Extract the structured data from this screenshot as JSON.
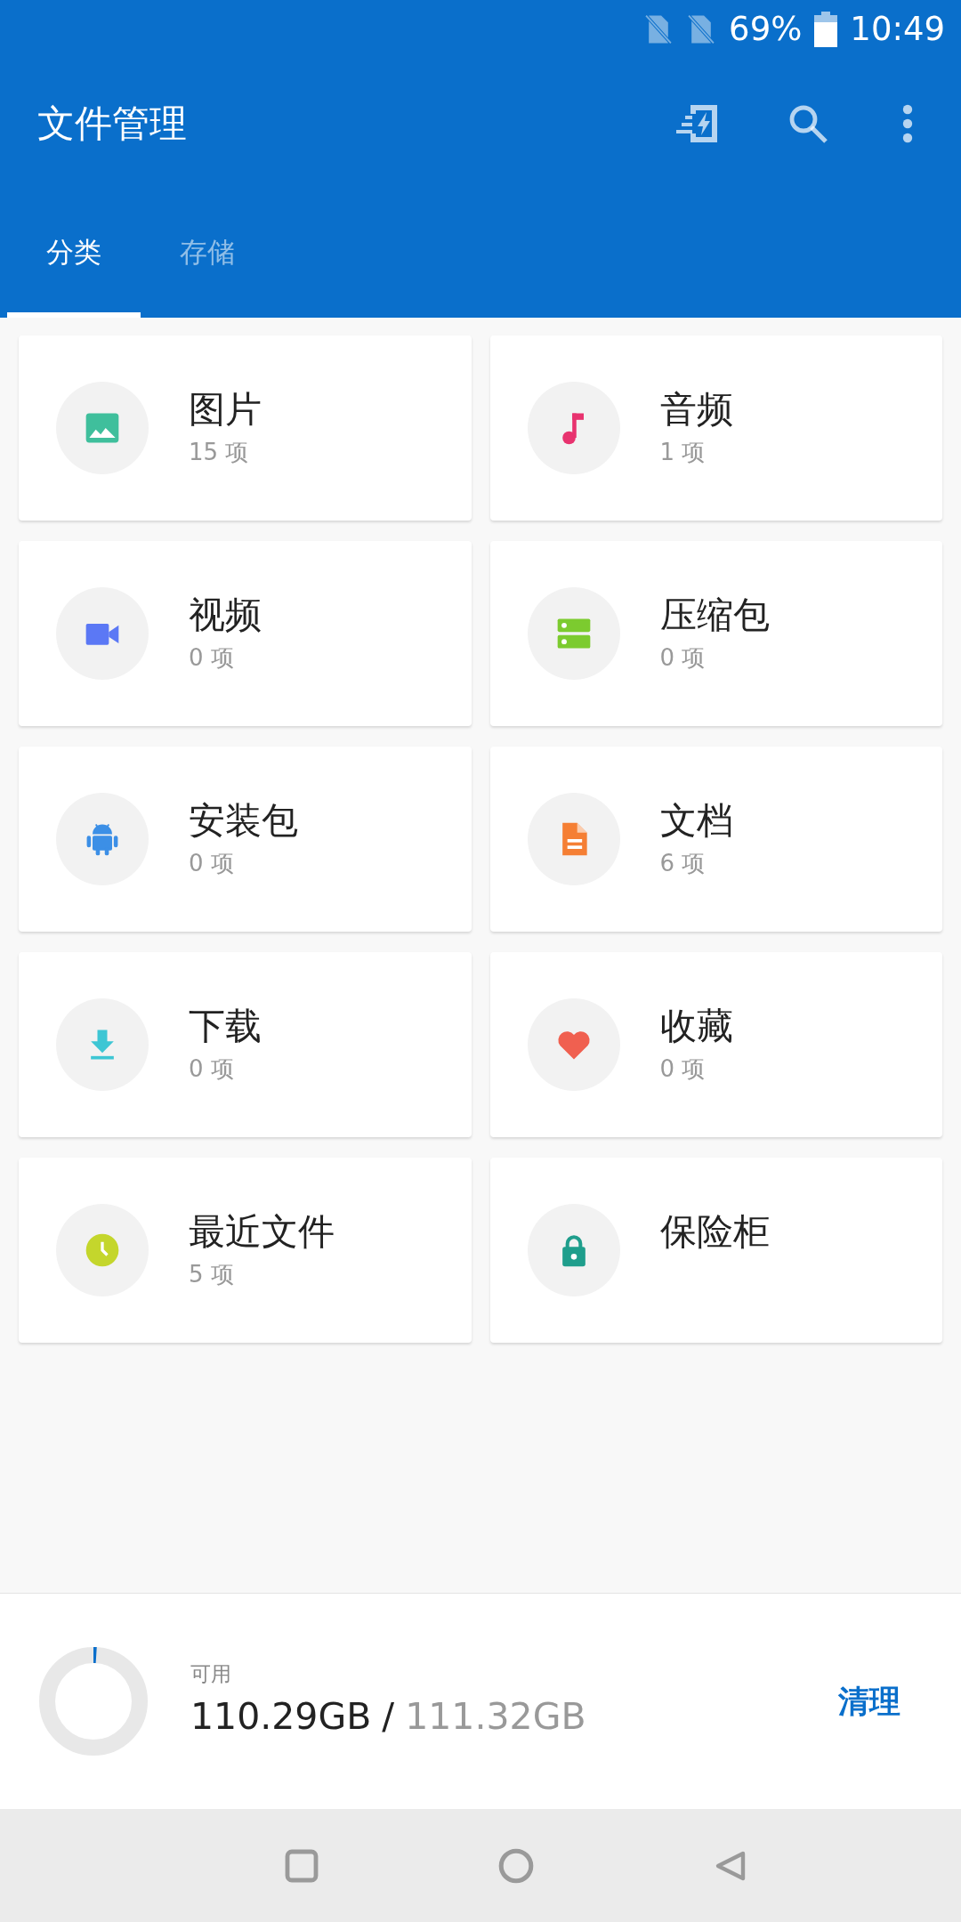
{
  "status_bar": {
    "battery": "69%",
    "time": "10:49"
  },
  "app_bar": {
    "title": "文件管理"
  },
  "tabs": [
    {
      "label": "分类",
      "selected": true
    },
    {
      "label": "存储",
      "selected": false
    }
  ],
  "categories": [
    {
      "kind": "image",
      "color": "#3fbf9c",
      "name": "图片",
      "count": "15 项"
    },
    {
      "kind": "music",
      "color": "#e8336f",
      "name": "音频",
      "count": "1 项"
    },
    {
      "kind": "video",
      "color": "#5b78f5",
      "name": "视频",
      "count": "0 项"
    },
    {
      "kind": "archive",
      "color": "#7ccb2f",
      "name": "压缩包",
      "count": "0 项"
    },
    {
      "kind": "apk",
      "color": "#3c8fe6",
      "name": "安装包",
      "count": "0 项"
    },
    {
      "kind": "doc",
      "color": "#f57f34",
      "name": "文档",
      "count": "6 项"
    },
    {
      "kind": "download",
      "color": "#3dc6d4",
      "name": "下载",
      "count": "0 项"
    },
    {
      "kind": "favorite",
      "color": "#f06050",
      "name": "收藏",
      "count": "0 项"
    },
    {
      "kind": "recent",
      "color": "#c4d62c",
      "name": "最近文件",
      "count": "5 项"
    },
    {
      "kind": "vault",
      "color": "#1f9e8c",
      "name": "保险柜"
    }
  ],
  "storage": {
    "level": 0.01,
    "label": "可用",
    "free": "110.29GB",
    "separator": "/",
    "total": "111.32GB",
    "action": "清理"
  }
}
